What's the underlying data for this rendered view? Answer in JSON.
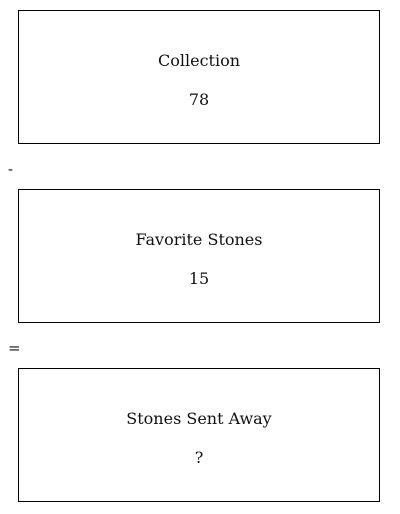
{
  "boxes": {
    "collection": {
      "label": "Collection",
      "value": "78"
    },
    "favorites": {
      "label": "Favorite Stones",
      "value": "15"
    },
    "sent_away": {
      "label": "Stones Sent Away",
      "value": "?"
    }
  },
  "operators": {
    "minus": "-",
    "equals": "="
  }
}
